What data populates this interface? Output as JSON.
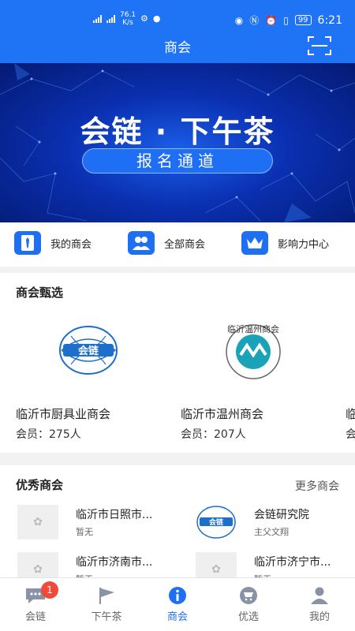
{
  "status_bar": {
    "speed": "76.1",
    "speed_unit": "K/s",
    "battery": "99",
    "time": "6:21"
  },
  "header": {
    "title": "商会",
    "scan_icon": "scan-icon"
  },
  "banner": {
    "title": "会链 · 下午茶",
    "button_label": "报名通道"
  },
  "quick_nav": [
    {
      "label": "我的商会",
      "icon": "tie-icon"
    },
    {
      "label": "全部商会",
      "icon": "people-icon"
    },
    {
      "label": "影响力中心",
      "icon": "crown-icon"
    }
  ],
  "selected": {
    "title": "商会甄选",
    "cards": [
      {
        "name": "临沂市厨具业商会",
        "members": "会员：275人",
        "logo_text": "会链"
      },
      {
        "name": "临沂市温州商会",
        "members": "会员：207人",
        "logo_text": "临沂温州商会"
      },
      {
        "name": "临",
        "members": "会"
      }
    ]
  },
  "excellent": {
    "title": "优秀商会",
    "more": "更多商会",
    "items": [
      {
        "name": "临沂市日照市...",
        "sub": "暂无"
      },
      {
        "name": "会链研究院",
        "sub": "主父文翔",
        "logo_text": "会链"
      },
      {
        "name": "临沂市济南市...",
        "sub": "暂无"
      },
      {
        "name": "临沂市济宁市...",
        "sub": "暂无"
      }
    ]
  },
  "tabbar": {
    "tabs": [
      {
        "label": "会链",
        "badge": "1",
        "icon": "chat-icon"
      },
      {
        "label": "下午茶",
        "icon": "flag-icon"
      },
      {
        "label": "商会",
        "icon": "info-icon"
      },
      {
        "label": "优选",
        "icon": "cart-icon"
      },
      {
        "label": "我的",
        "icon": "user-icon"
      }
    ]
  },
  "colors": {
    "primary": "#1f74f5",
    "badge": "#f04a3a"
  }
}
